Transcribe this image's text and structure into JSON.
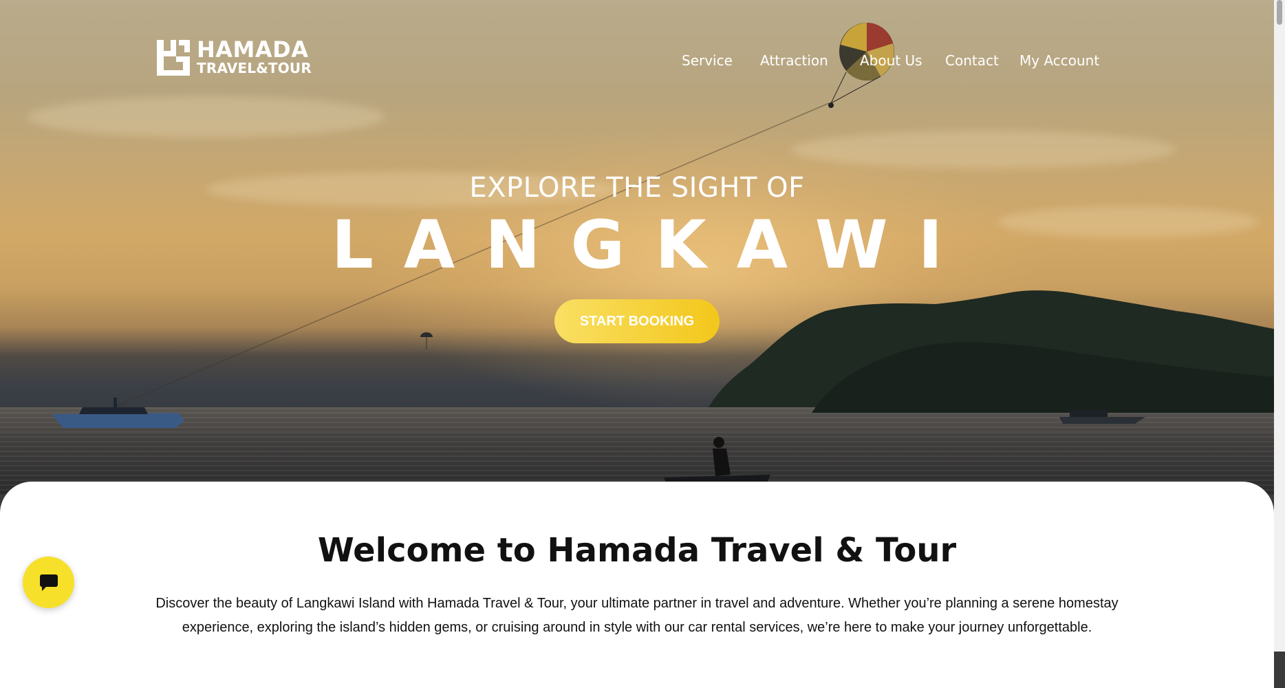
{
  "brand": {
    "name": "HAMADA",
    "tagline": "TRAVEL&TOUR"
  },
  "nav": {
    "items": [
      "Service",
      "Attraction",
      "About Us",
      "Contact",
      "My Account"
    ]
  },
  "hero": {
    "kicker": "EXPLORE THE SIGHT OF",
    "headline": "LANGKAWI",
    "cta_label": "START BOOKING"
  },
  "welcome": {
    "title": "Welcome to Hamada Travel & Tour",
    "body": "Discover the beauty of Langkawi Island with Hamada Travel & Tour, your ultimate partner in travel and adventure. Whether you’re planning a serene homestay experience, exploring the island’s hidden gems, or cruising around in style with our car rental services, we’re here to make your journey unforgettable."
  },
  "chat": {
    "icon": "chat-bubble-icon"
  },
  "colors": {
    "accent": "#f7e02a",
    "cta_start": "#f9df63",
    "cta_end": "#f3c71b"
  }
}
